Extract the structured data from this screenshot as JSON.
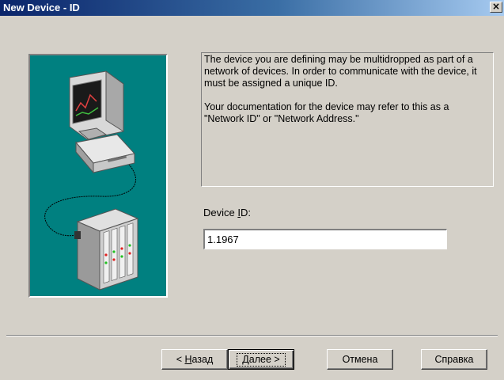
{
  "window": {
    "title": "New Device - ID",
    "close_glyph": "×"
  },
  "description": {
    "paragraph1": "The device you are defining may be multidropped as part of a network of devices.  In order to communicate with the device, it must be assigned a unique ID.",
    "paragraph2": "Your documentation for the device may refer to this as a \"Network ID\" or \"Network Address.\""
  },
  "device_id": {
    "label_before": "Device ",
    "label_mnemonic": "I",
    "label_after": "D:",
    "value": "1.1967"
  },
  "buttons": {
    "back": {
      "prefix": "< ",
      "mnemonic": "Н",
      "rest": "азад"
    },
    "next": {
      "mnemonic": "Д",
      "rest": "алее",
      "suffix": " >"
    },
    "cancel": "Отмена",
    "help": "Справка"
  },
  "colors": {
    "panel_bg": "#008080",
    "dialog_bg": "#d4d0c8",
    "title_start": "#0a246a",
    "title_end": "#a6caf0"
  },
  "icons": {
    "illustration": "computer-connected-to-network-device",
    "close": "close-icon"
  }
}
